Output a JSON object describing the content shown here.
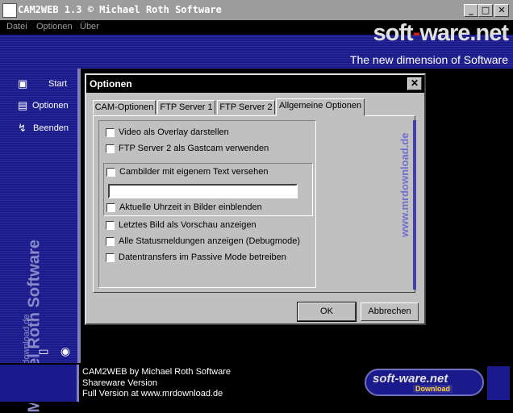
{
  "window": {
    "title": "CAM2WEB 1.3 © Michael Roth Software",
    "minimize": "_",
    "maximize": "□",
    "close": "✕"
  },
  "menu": {
    "items": [
      "Datei",
      "Optionen",
      "Über"
    ]
  },
  "banner": {
    "logo_left": "soft",
    "logo_dash": "-",
    "logo_right": "ware.net",
    "tagline": "The new dimension of Software"
  },
  "sidebar": {
    "items": [
      {
        "label": "Start",
        "icon": "camera-icon"
      },
      {
        "label": "Optionen",
        "icon": "settings-icon"
      },
      {
        "label": "Beenden",
        "icon": "exit-icon"
      }
    ],
    "vertical_title": "Michael Roth Software",
    "vertical_url": "www.mrdownload.de"
  },
  "dialog": {
    "title": "Optionen",
    "close": "✕",
    "tabs": [
      "CAM-Optionen",
      "FTP Server 1",
      "FTP Server 2",
      "Allgemeine Optionen"
    ],
    "active_tab": 3,
    "options": {
      "overlay": "Video als Overlay darstellen",
      "gastcam": "FTP Server 2 als Gastcam verwenden",
      "own_text": "Cambilder mit eigenem Text versehen",
      "own_text_value": "",
      "time": "Aktuelle Uhrzeit in Bilder einblenden",
      "preview": "Letztes Bild als Vorschau anzeigen",
      "debug": "Alle Statusmeldungen anzeigen (Debugmode)",
      "passive": "Datentransfers im Passive Mode betreiben"
    },
    "watermark": "www.mrdownload.de",
    "ok": "OK",
    "cancel": "Abbrechen"
  },
  "footer": {
    "line1": "CAM2WEB by Michael Roth Software",
    "line2": "Shareware Version",
    "line3": "Full Version at www.mrdownload.de",
    "logo": "soft-ware.net",
    "logo_sub": "Download"
  },
  "colors": {
    "brand_blue": "#1a1a8c",
    "accent_red": "#d02020"
  }
}
